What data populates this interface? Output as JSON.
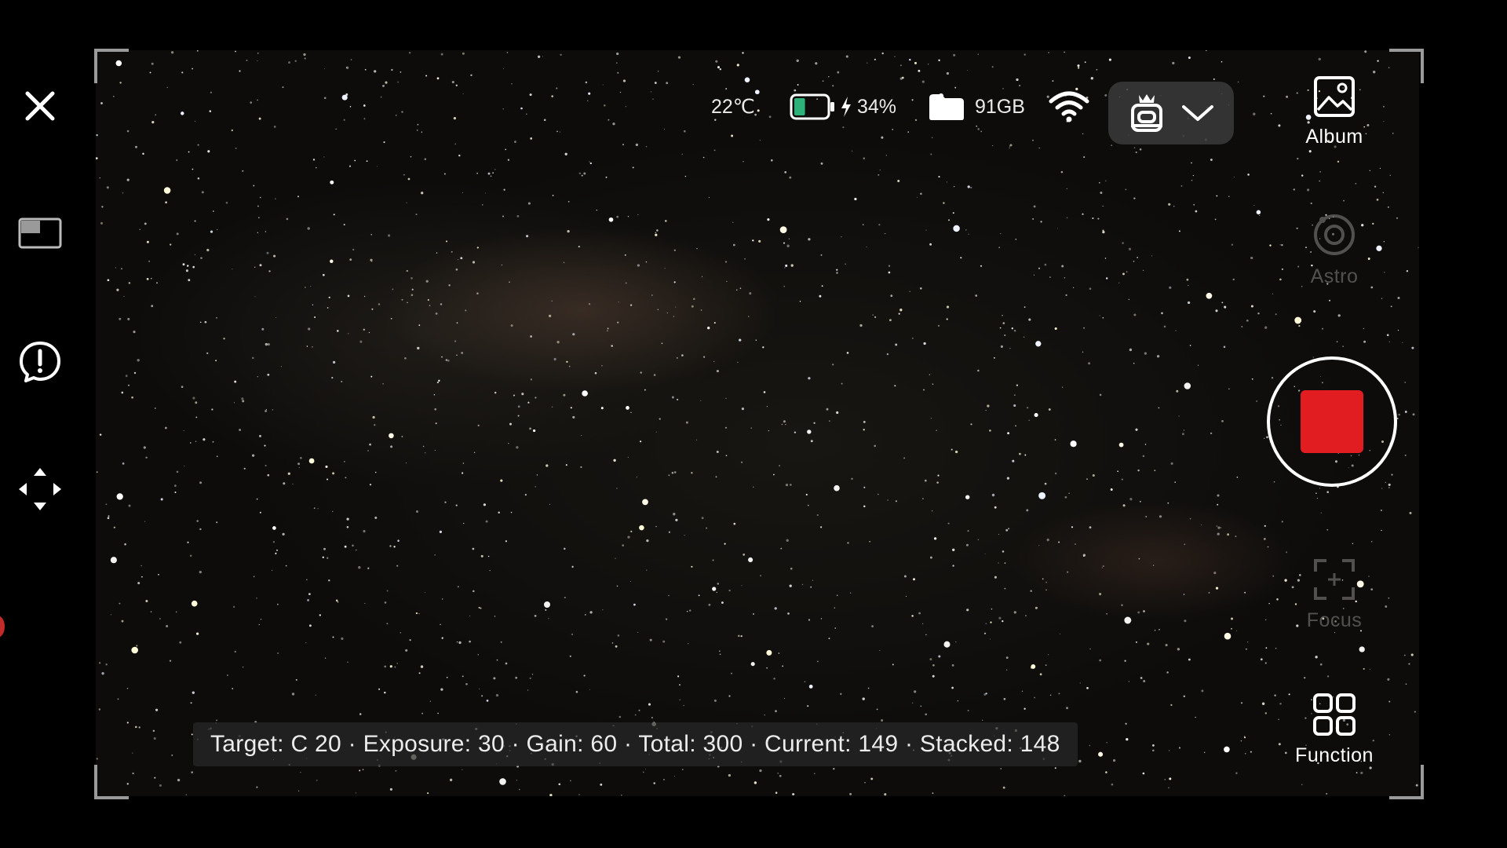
{
  "status": {
    "temperature": "22℃",
    "battery_percent": "34%",
    "battery_level": 0.34,
    "storage": "91GB"
  },
  "right_panel": {
    "album_label": "Album",
    "astro_label": "Astro",
    "focus_label": "Focus",
    "function_label": "Function"
  },
  "info_bar": {
    "text": "Target: C 20 · Exposure: 30 · Gain: 60 · Total: 300 · Current: 149 · Stacked: 148"
  },
  "colors": {
    "stop_button": "#e11d22",
    "battery_fill": "#2db37a",
    "background": "#000000"
  },
  "icons": {
    "left_rail": [
      "close-icon",
      "picture-in-picture-icon",
      "alert-bubble-icon",
      "move-arrows-icon"
    ],
    "status": [
      "battery-icon",
      "charging-bolt-icon",
      "folder-icon",
      "wifi-icon",
      "telescope-device-icon",
      "chevron-down-icon"
    ],
    "right_panel": [
      "album-icon",
      "astro-icon",
      "stop-recording-icon",
      "focus-icon",
      "function-grid-icon"
    ]
  }
}
